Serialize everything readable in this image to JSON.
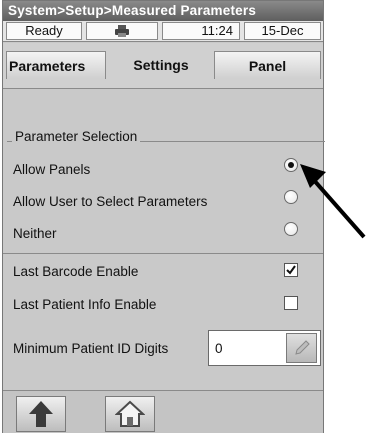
{
  "breadcrumb": "System>Setup>Measured Parameters",
  "status": {
    "state": "Ready",
    "time": "11:24",
    "date": "15-Dec",
    "device_icon": "printer-icon"
  },
  "tabs": [
    {
      "label": "Parameters",
      "selected": false
    },
    {
      "label": "Settings",
      "selected": true
    },
    {
      "label": "Panel",
      "selected": false
    }
  ],
  "parameter_selection": {
    "legend": "Parameter Selection",
    "options": [
      {
        "label": "Allow Panels",
        "selected": true
      },
      {
        "label": "Allow User to Select Parameters",
        "selected": false
      },
      {
        "label": "Neither",
        "selected": false
      }
    ]
  },
  "settings": {
    "last_barcode_label": "Last Barcode Enable",
    "last_barcode_checked": true,
    "last_patient_label": "Last Patient Info Enable",
    "last_patient_checked": false,
    "min_patient_id_label": "Minimum Patient ID Digits",
    "min_patient_id_value": "0"
  },
  "toolbar": {
    "up_icon": "up-arrow-icon",
    "home_icon": "home-icon"
  },
  "colors": {
    "title_bar": "#6e6e6e",
    "panel_bg": "#c9c9c9"
  }
}
